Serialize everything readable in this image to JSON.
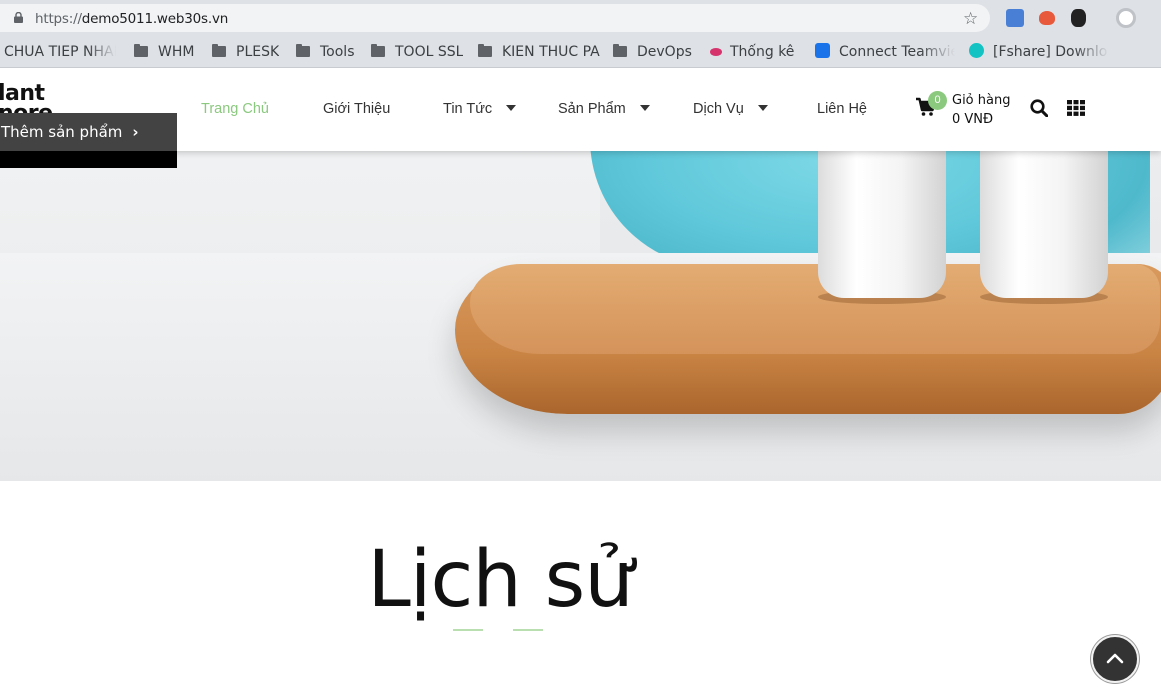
{
  "browser": {
    "url_scheme": "https://",
    "url_host": "demo5011.web30s.vn",
    "bookmarks": [
      "CHUA TIEP NHAN",
      "WHM",
      "PLESK",
      "Tools",
      "TOOL SSL",
      "KIEN THUC PA",
      "DevOps",
      "Thống kê",
      "Connect Teamvie",
      "[Fshare] Downlo"
    ]
  },
  "header": {
    "logo_line1": "lant",
    "logo_line2": "nore",
    "add_product_label": "Thêm sản phẩm",
    "nav": [
      {
        "label": "Trang Chủ",
        "active": true
      },
      {
        "label": "Giới Thiệu",
        "active": false
      },
      {
        "label": "Tin Tức",
        "active": false,
        "dropdown": true
      },
      {
        "label": "Sản Phẩm",
        "active": false,
        "dropdown": true
      },
      {
        "label": "Dịch Vụ",
        "active": false,
        "dropdown": true
      },
      {
        "label": "Liên Hệ",
        "active": false
      }
    ],
    "cart": {
      "count": "0",
      "label": "Giỏ hàng",
      "total": "0 VNĐ"
    }
  },
  "section": {
    "title": "Lịch sử"
  },
  "colors": {
    "accent": "#8bc97f",
    "dark": "#333333"
  },
  "icons": [
    "lock-icon",
    "star-icon",
    "folder-icon",
    "cart-icon",
    "search-icon",
    "grid-icon",
    "chevron-up-icon"
  ]
}
